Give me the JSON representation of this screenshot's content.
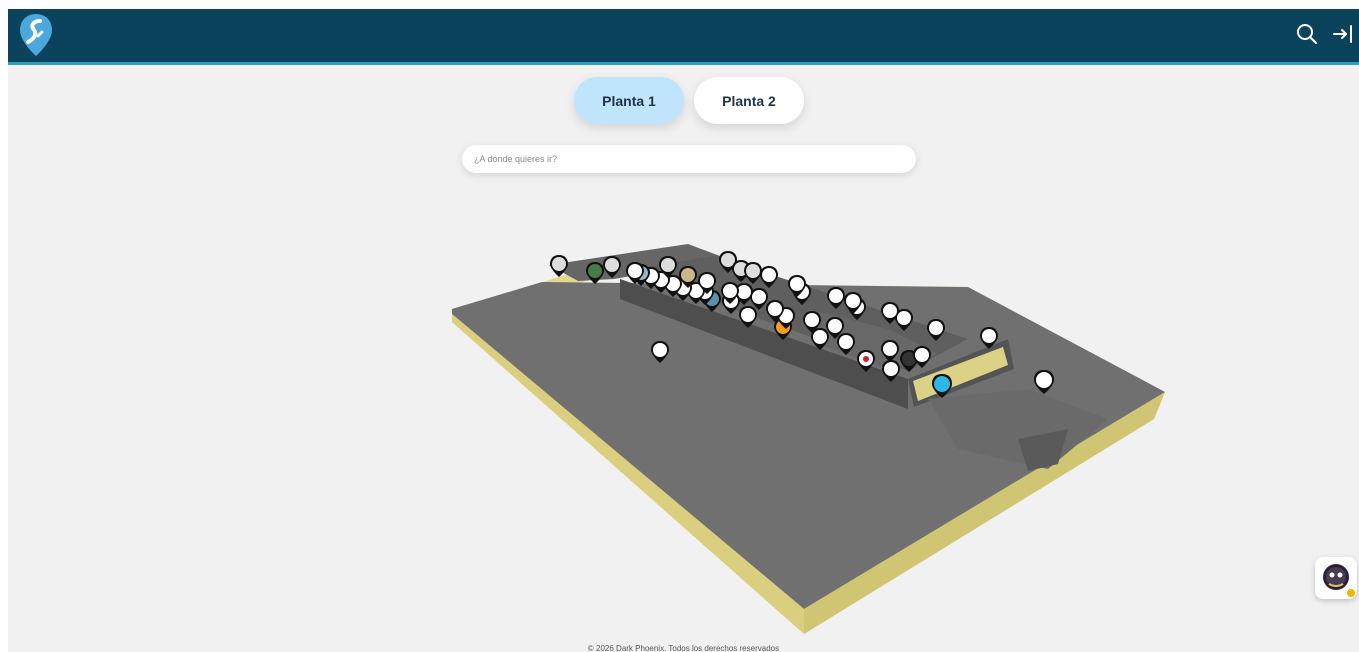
{
  "header": {
    "logo_icon": "location-pin-logo",
    "search_icon": "search-icon",
    "login_icon": "login-icon",
    "bg_color": "#0b435c"
  },
  "floors": [
    {
      "label": "Planta 1",
      "active": true
    },
    {
      "label": "Planta 2",
      "active": false
    }
  ],
  "search": {
    "placeholder": "¿A dónde quieres ir?"
  },
  "map": {
    "floor_color": "#707070",
    "edge_color": "#e2d88c",
    "marker_count": 50
  },
  "assistant": {
    "icon": "assistant-avatar-icon",
    "status_color": "#f5b400"
  },
  "footer": {
    "text": "©  2026 Dark Phoenix. Todos los derechos reservados"
  }
}
